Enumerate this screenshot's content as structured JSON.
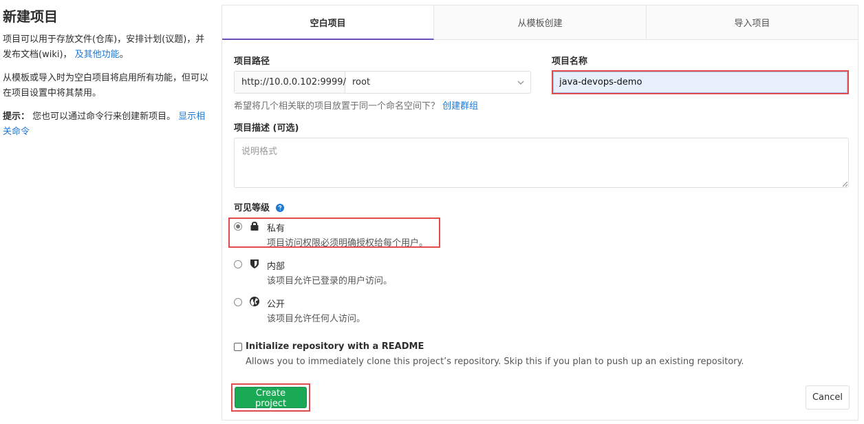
{
  "intro": {
    "title": "新建项目",
    "para1_text": "项目可以用于存放文件(仓库)，安排计划(议题)，并发布文档(wiki)， ",
    "para1_link": "及其他功能",
    "para1_end": "。",
    "para2": "从模板或导入时为空白项目将启用所有功能，但可以在项目设置中将其禁用。",
    "tip_label": "提示：",
    "tip_text": " 您也可以通过命令行来创建新项目。 ",
    "tip_link": "显示相关命令"
  },
  "tabs": [
    {
      "label": "空白项目",
      "active": true
    },
    {
      "label": "从模板创建",
      "active": false
    },
    {
      "label": "导入项目",
      "active": false
    }
  ],
  "form": {
    "path_label": "项目路径",
    "path_prefix": "http://10.0.0.102:9999/",
    "namespace": "root",
    "name_label": "项目名称",
    "name_value": "java-devops-demo",
    "group_help": "希望将几个相关联的项目放置于同一个命名空间下？",
    "group_link": "创建群组",
    "desc_label": "项目描述 (可选)",
    "desc_placeholder": "说明格式",
    "visibility_label": "可见等级",
    "visibility": [
      {
        "title": "私有",
        "desc": "项目访问权限必须明确授权给每个用户。",
        "checked": true,
        "icon": "lock-icon"
      },
      {
        "title": "内部",
        "desc": "该项目允许已登录的用户访问。",
        "checked": false,
        "icon": "shield-icon"
      },
      {
        "title": "公开",
        "desc": "该项目允许任何人访问。",
        "checked": false,
        "icon": "globe-icon"
      }
    ],
    "readme_label": "Initialize repository with a README",
    "readme_help": "Allows you to immediately clone this project’s repository. Skip this if you plan to push up an existing repository.",
    "create_label": "Create project",
    "cancel_label": "Cancel"
  },
  "colors": {
    "accent": "#6b4fbb",
    "primary": "#1aaa55",
    "link": "#1f78d1",
    "highlight": "#e04c4c"
  }
}
